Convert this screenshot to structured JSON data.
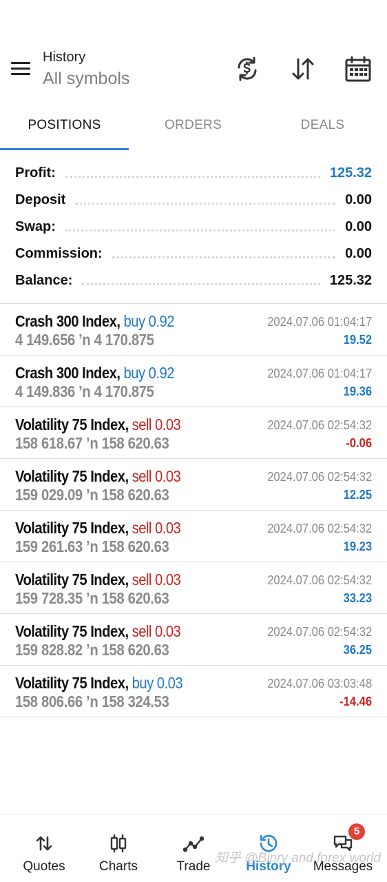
{
  "header": {
    "title": "History",
    "subtitle": "All symbols",
    "icons": [
      "menu-icon",
      "sync-icon",
      "sort-icon",
      "calendar-icon"
    ]
  },
  "tabs": [
    {
      "label": "POSITIONS",
      "active": true
    },
    {
      "label": "ORDERS",
      "active": false
    },
    {
      "label": "DEALS",
      "active": false
    }
  ],
  "summary": {
    "profit": {
      "label": "Profit:",
      "value": "125.32"
    },
    "deposit": {
      "label": "Deposit",
      "value": "0.00"
    },
    "swap": {
      "label": "Swap:",
      "value": "0.00"
    },
    "commission": {
      "label": "Commission:",
      "value": "0.00"
    },
    "balance": {
      "label": "Balance:",
      "value": "125.32"
    }
  },
  "positions": [
    {
      "symbol": "Crash 300 Index,",
      "direction": "buy 0.92",
      "type": "buy",
      "prices": "4 149.656 ’n  4 170.875",
      "time": "2024.07.06 01:04:17",
      "profit": "19.52",
      "sign": "pos"
    },
    {
      "symbol": "Crash 300 Index,",
      "direction": "buy 0.92",
      "type": "buy",
      "prices": "4 149.836 ’n  4 170.875",
      "time": "2024.07.06 01:04:17",
      "profit": "19.36",
      "sign": "pos"
    },
    {
      "symbol": "Volatility 75 Index,",
      "direction": "sell 0.03",
      "type": "sell",
      "prices": "158 618.67 ’n  158 620.63",
      "time": "2024.07.06 02:54:32",
      "profit": "-0.06",
      "sign": "neg"
    },
    {
      "symbol": "Volatility 75 Index,",
      "direction": "sell 0.03",
      "type": "sell",
      "prices": "159 029.09 ’n  158 620.63",
      "time": "2024.07.06 02:54:32",
      "profit": "12.25",
      "sign": "pos"
    },
    {
      "symbol": "Volatility 75 Index,",
      "direction": "sell 0.03",
      "type": "sell",
      "prices": "159 261.63 ’n  158 620.63",
      "time": "2024.07.06 02:54:32",
      "profit": "19.23",
      "sign": "pos"
    },
    {
      "symbol": "Volatility 75 Index,",
      "direction": "sell 0.03",
      "type": "sell",
      "prices": "159 728.35 ’n  158 620.63",
      "time": "2024.07.06 02:54:32",
      "profit": "33.23",
      "sign": "pos"
    },
    {
      "symbol": "Volatility 75 Index,",
      "direction": "sell 0.03",
      "type": "sell",
      "prices": "159 828.82 ’n  158 620.63",
      "time": "2024.07.06 02:54:32",
      "profit": "36.25",
      "sign": "pos"
    },
    {
      "symbol": "Volatility 75 Index,",
      "direction": "buy 0.03",
      "type": "buy",
      "prices": "158 806.66 ’n  158 324.53",
      "time": "2024.07.06 03:03:48",
      "profit": "-14.46",
      "sign": "neg"
    }
  ],
  "bottom_nav": {
    "quotes": "Quotes",
    "charts": "Charts",
    "trade": "Trade",
    "history": "History",
    "messages": "Messages",
    "messages_badge": "5",
    "active": "history"
  },
  "watermark": "知乎 @Binry and forex world",
  "colors": {
    "accent": "#2a86d6",
    "buy": "#1f78c8",
    "sell": "#c8231f",
    "muted": "#8a8a8a",
    "badge": "#e0423a"
  }
}
